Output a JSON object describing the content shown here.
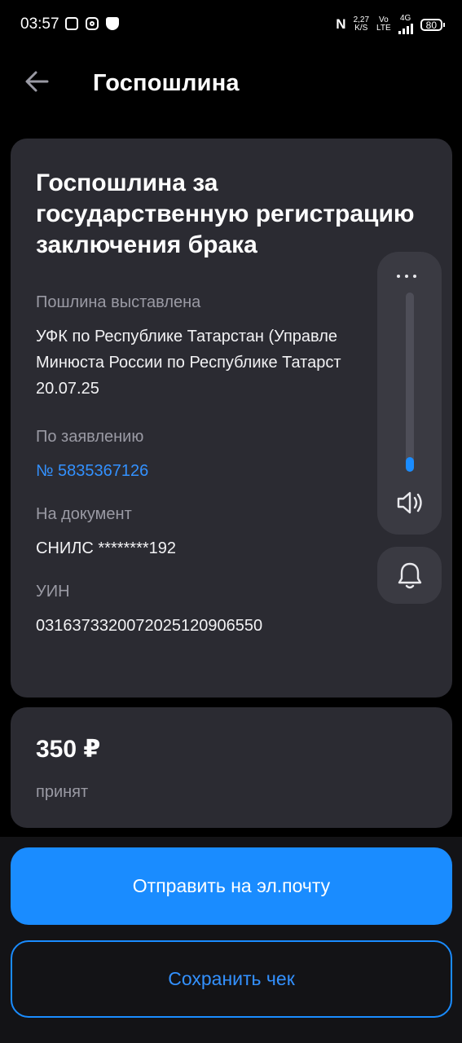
{
  "status_bar": {
    "time": "03:57",
    "nfc": "N",
    "speed_value": "2,27",
    "speed_unit": "K/S",
    "volte_top": "Vo",
    "volte_bottom": "LTE",
    "network": "4G",
    "battery": "80"
  },
  "header": {
    "title": "Госпошлина"
  },
  "details": {
    "title": "Госпошлина за государственную регистрацию заключения брака",
    "issued_label": "Пошлина выставлена",
    "issued_line1": "УФК по Республике Татарстан (Управле",
    "issued_line2": "Минюста России по Республике Татарст",
    "issued_date": "20.07.25",
    "application_label": "По заявлению",
    "application_number": "№ 5835367126",
    "document_label": "На документ",
    "document_value": "СНИЛС ********192",
    "uin_label": "УИН",
    "uin_value": "0316373320072025120906550"
  },
  "payment": {
    "amount": "350 ₽",
    "status": "принят"
  },
  "actions": {
    "email_label": "Отправить на эл.почту",
    "save_label": "Сохранить чек"
  },
  "volume": {
    "level_fraction": 0.08
  },
  "colors": {
    "accent": "#1a8cff",
    "card": "#2b2b32",
    "background": "#000000"
  }
}
